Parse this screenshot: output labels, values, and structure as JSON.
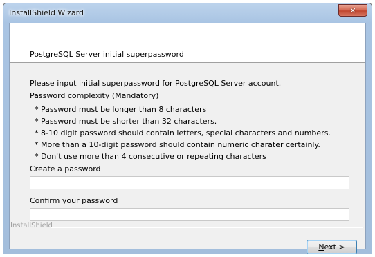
{
  "window": {
    "title": "InstallShield Wizard",
    "close_symbol": "✕"
  },
  "header": {
    "title": "PostgreSQL Server initial superpassword"
  },
  "body": {
    "intro": "Please input initial superpassword for PostgreSQL Server account.",
    "complexity_heading": "Password complexity (Mandatory)",
    "rules": [
      "* Password must be longer than 8 characters",
      "* Password must be shorter than 32 characters.",
      "* 8-10 digit password should contain letters, special characters and numbers.",
      "* More than a 10-digit password should contain numeric charater certainly.",
      "* Don't use more than 4 consecutive or repeating characters"
    ],
    "create_label": "Create a password",
    "create_value": "",
    "confirm_label": "Confirm your password",
    "confirm_value": ""
  },
  "footer": {
    "brand": "InstallShield",
    "next_mnemonic": "N",
    "next_rest": "ext >"
  },
  "colors": {
    "title_bar": "#a9c4e3",
    "close_button": "#c0452e",
    "dialog_background": "#f0f0f0",
    "header_background": "#ffffff",
    "default_button_border": "#3c7fb1"
  },
  "icons": {
    "close": "close-icon"
  }
}
